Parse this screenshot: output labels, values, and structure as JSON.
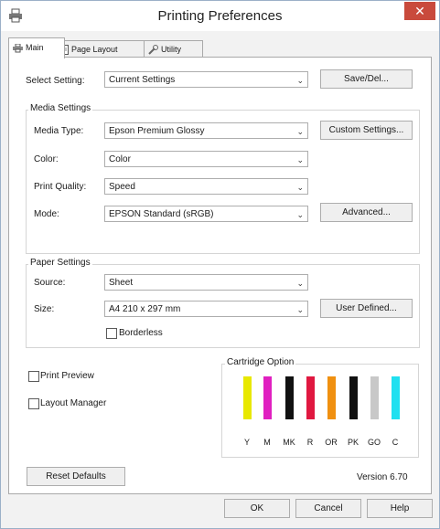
{
  "window": {
    "title": "Printing Preferences",
    "close_glyph": "✕",
    "app_icon": "printer-icon"
  },
  "tabs": [
    {
      "label": "Main",
      "icon": "printer-icon"
    },
    {
      "label": "Page Layout",
      "icon": "page-icon"
    },
    {
      "label": "Utility",
      "icon": "wrench-icon"
    }
  ],
  "select_setting": {
    "label": "Select Setting:",
    "value": "Current Settings",
    "button": "Save/Del..."
  },
  "media": {
    "group_title": "Media Settings",
    "media_type_label": "Media Type:",
    "media_type": "Epson Premium Glossy",
    "custom_button": "Custom Settings...",
    "color_label": "Color:",
    "color": "Color",
    "quality_label": "Print Quality:",
    "quality": "Speed",
    "mode_label": "Mode:",
    "mode": "EPSON Standard (sRGB)",
    "advanced_button": "Advanced..."
  },
  "paper": {
    "group_title": "Paper Settings",
    "source_label": "Source:",
    "source": "Sheet",
    "size_label": "Size:",
    "size": "A4 210 x 297 mm",
    "user_defined_button": "User Defined...",
    "borderless_label": "Borderless"
  },
  "print_preview_label": "Print Preview",
  "layout_manager_label": "Layout Manager",
  "cartridge": {
    "title": "Cartridge Option",
    "inks": [
      {
        "label": "Y",
        "color": "#e8e800"
      },
      {
        "label": "M",
        "color": "#e020c0"
      },
      {
        "label": "MK",
        "color": "#111111"
      },
      {
        "label": "R",
        "color": "#e01840"
      },
      {
        "label": "OR",
        "color": "#f09010"
      },
      {
        "label": "PK",
        "color": "#111111"
      },
      {
        "label": "GO",
        "color": "#c8c8c8"
      },
      {
        "label": "C",
        "color": "#20e0f0"
      }
    ]
  },
  "reset_button": "Reset Defaults",
  "version": "Version 6.70",
  "footer": {
    "ok": "OK",
    "cancel": "Cancel",
    "help": "Help"
  }
}
